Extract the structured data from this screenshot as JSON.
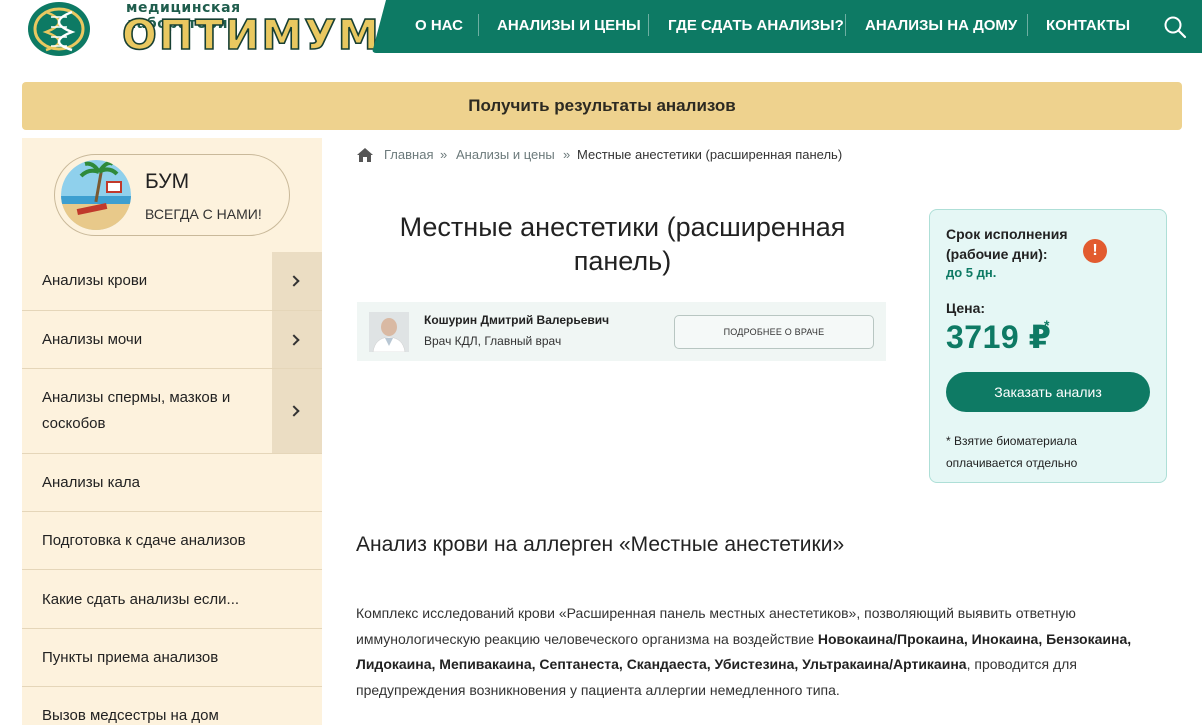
{
  "header": {
    "logo_small": "медицинская лаборатория",
    "logo_big": "оптимум",
    "nav": [
      "О НАС",
      "АНАЛИЗЫ И ЦЕНЫ",
      "ГДЕ СДАТЬ АНАЛИЗЫ?",
      "АНАЛИЗЫ НА ДОМУ",
      "КОНТАКТЫ"
    ],
    "search_icon": "search-icon",
    "nav_color": "#0d7a64"
  },
  "results_bar": {
    "label": "Получить результаты анализов",
    "color": "#eed28e"
  },
  "sidebar": {
    "promo": {
      "title": "БУМ",
      "subtitle": "ВСЕГДА С НАМИ!"
    },
    "items": [
      {
        "label": "Анализы крови",
        "has_arrow": true
      },
      {
        "label": "Анализы мочи",
        "has_arrow": true
      },
      {
        "label": "Анализы спермы, мазков и соскобов",
        "has_arrow": true
      },
      {
        "label": "Анализы кала",
        "has_arrow": false
      },
      {
        "label": "Подготовка к сдаче анализов",
        "has_arrow": false
      },
      {
        "label": "Какие сдать анализы если...",
        "has_arrow": false
      },
      {
        "label": "Пункты приема анализов",
        "has_arrow": false
      },
      {
        "label": "Вызов медсестры на дом",
        "has_arrow": false
      }
    ]
  },
  "breadcrumb": {
    "items": [
      "Главная",
      "Анализы и цены",
      "Местные анестетики (расширенная панель)"
    ],
    "separator": "»"
  },
  "page_title": "Местные анестетики (расширенная панель)",
  "doctor": {
    "name": "Кошурин Дмитрий Валерьевич",
    "role": "Врач КДЛ, Главный врач",
    "button": "ПОДРОБНЕЕ О ВРАЧЕ"
  },
  "pricebox": {
    "term_label": "Срок исполнения (рабочие дни):",
    "term_value": "до 5 дн.",
    "alert_icon": "!",
    "price_label": "Цена:",
    "price": "3719 ₽",
    "price_star": "*",
    "order_button": "Заказать анализ",
    "note": "* Взятие биоматериала оплачивается отдельно",
    "accent": "#0e7a64"
  },
  "article": {
    "heading": "Анализ крови на аллерген «Местные анестетики»",
    "text_before": "Комплекс исследований крови «Расширенная панель местных анестетиков», позволяющий выявить ответную иммунологическую реакцию человеческого организма на воздействие ",
    "text_bold": "Новокаина/Прокаина, Инокаина, Бензокаина, Лидокаина, Мепивакаина, Септанеста, Скандаеста, Убистезина, Ультракаина/Артикаина",
    "text_after": ", проводится для предупреждения возникновения у пациента аллергии немедленного типа."
  }
}
